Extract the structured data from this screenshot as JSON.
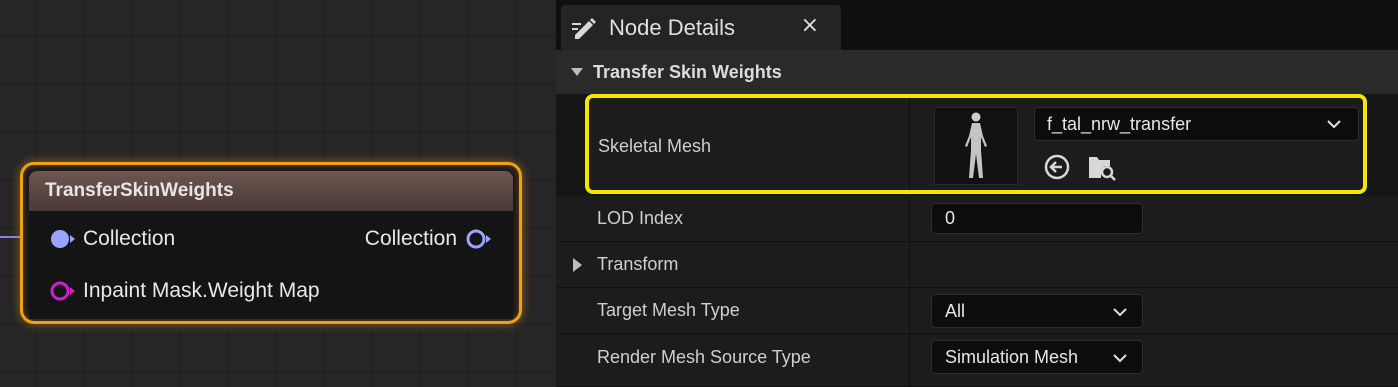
{
  "graph": {
    "node": {
      "title": "TransferSkinWeights",
      "input_pin_label": "Collection",
      "output_pin_label": "Collection",
      "mask_pin_label": "Inpaint Mask.Weight Map"
    },
    "colors": {
      "node_highlight": "#f0a010",
      "collection_pin": "#9aa3ff",
      "mask_pin": "#d01ec8"
    }
  },
  "details": {
    "tab_title": "Node Details",
    "tab_close": "×",
    "section_title": "Transfer Skin Weights",
    "skeletal_mesh": {
      "label": "Skeletal Mesh",
      "value": "f_tal_nrw_transfer",
      "highlight_color": "#f7e600"
    },
    "lod_index": {
      "label": "LOD Index",
      "value": "0"
    },
    "transform": {
      "label": "Transform"
    },
    "target_mesh_type": {
      "label": "Target Mesh Type",
      "value": "All"
    },
    "render_mesh_source_type": {
      "label": "Render Mesh Source Type",
      "value": "Simulation Mesh"
    }
  }
}
